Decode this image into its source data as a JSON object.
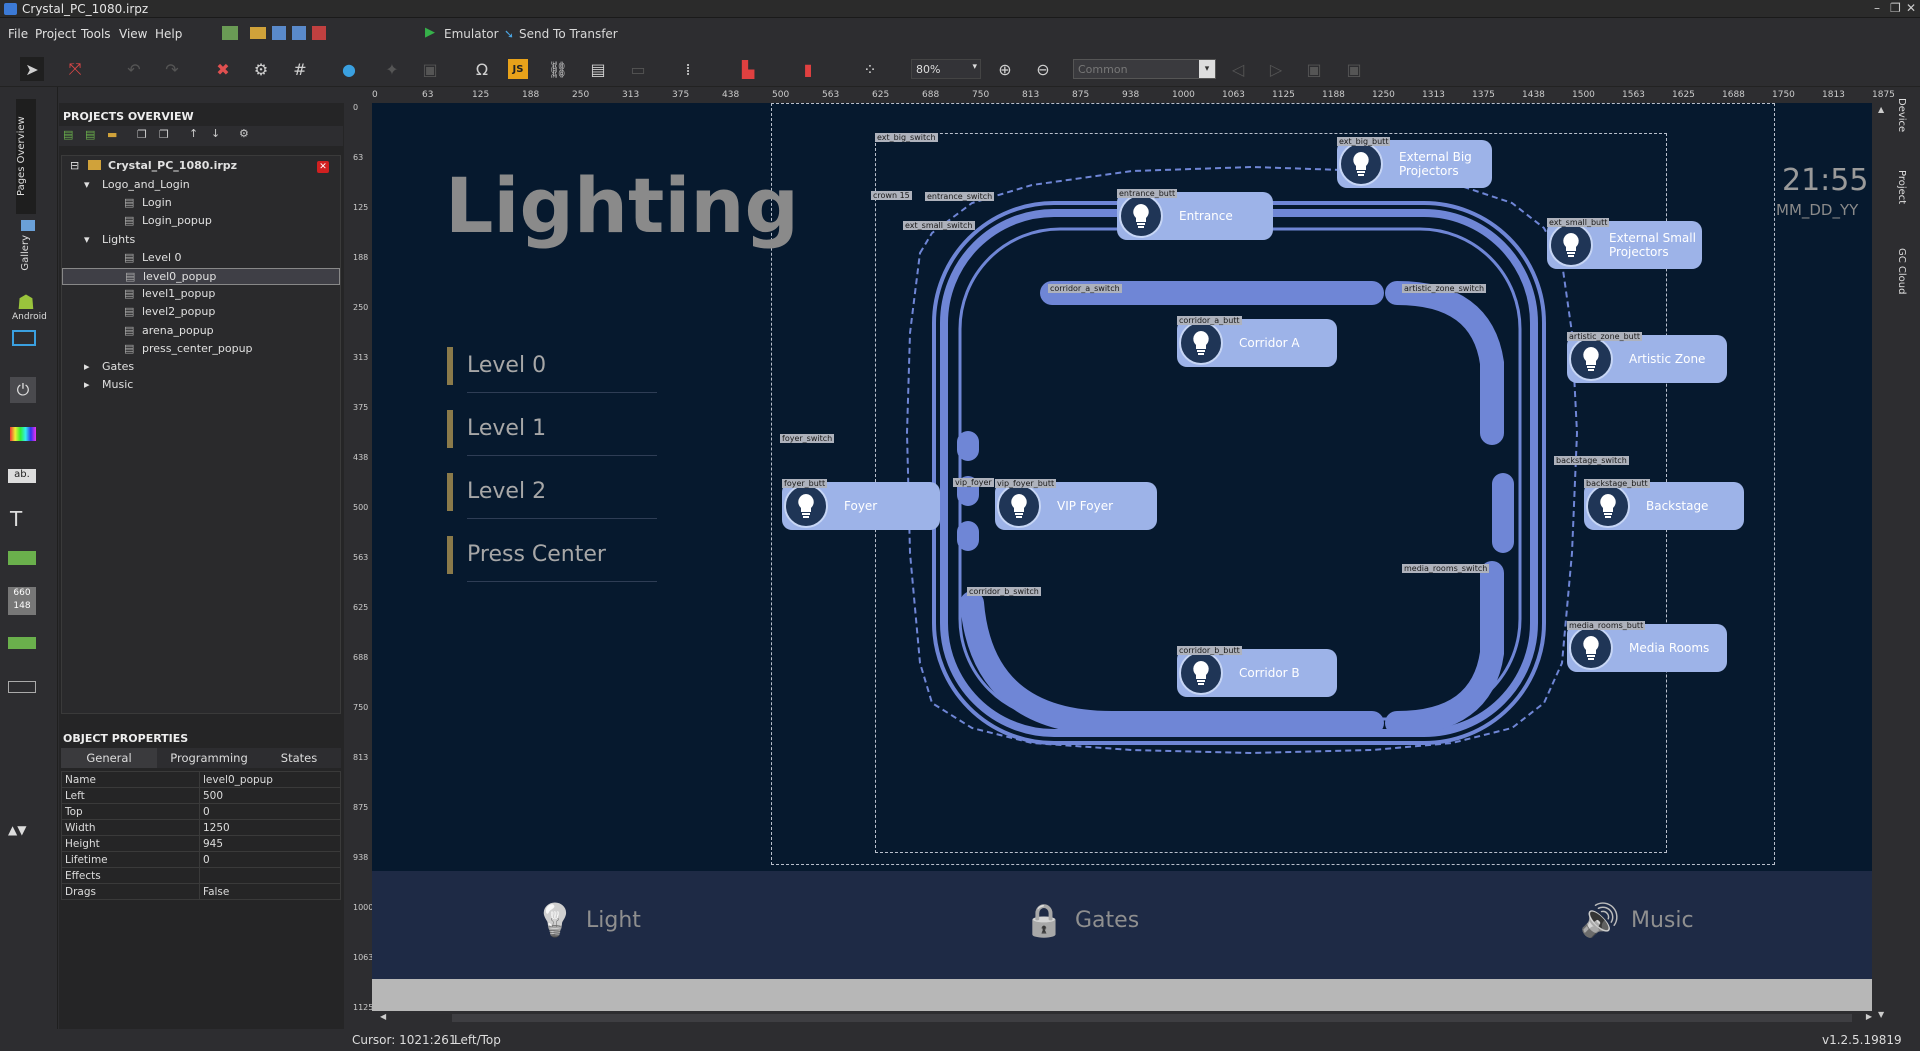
{
  "window": {
    "title": "Crystal_PC_1080.irpz",
    "controls": [
      "–",
      "❐",
      "✕"
    ]
  },
  "menu": {
    "items": [
      "File",
      "Project",
      "Tools",
      "View",
      "Help"
    ],
    "emulator": "Emulator",
    "send": "Send To Transfer"
  },
  "toolbar": {
    "zoom": "80%",
    "style_select": "Common"
  },
  "lefttabs": {
    "pages": "Pages Overview",
    "gallery": "Gallery",
    "android": "Android"
  },
  "righttabs": [
    "Device",
    "Project",
    "GC Cloud"
  ],
  "projects": {
    "header": "PROJECTS OVERVIEW",
    "root": "Crystal_PC_1080.irpz",
    "items": [
      {
        "label": "Logo_and_Login",
        "level": 1,
        "type": "folder"
      },
      {
        "label": "Login",
        "level": 2,
        "type": "page"
      },
      {
        "label": "Login_popup",
        "level": 2,
        "type": "popup"
      },
      {
        "label": "Lights",
        "level": 1,
        "type": "folder"
      },
      {
        "label": "Level 0",
        "level": 2,
        "type": "page"
      },
      {
        "label": "level0_popup",
        "level": 2,
        "type": "popup",
        "selected": true
      },
      {
        "label": "level1_popup",
        "level": 2,
        "type": "popup"
      },
      {
        "label": "level2_popup",
        "level": 2,
        "type": "popup"
      },
      {
        "label": "arena_popup",
        "level": 2,
        "type": "popup"
      },
      {
        "label": "press_center_popup",
        "level": 2,
        "type": "popup"
      },
      {
        "label": "Gates",
        "level": 1,
        "type": "collapsed"
      },
      {
        "label": "Music",
        "level": 1,
        "type": "collapsed"
      }
    ]
  },
  "props": {
    "header": "OBJECT PROPERTIES",
    "tabs": [
      "General",
      "Programming",
      "States"
    ],
    "rows": [
      [
        "Name",
        "level0_popup"
      ],
      [
        "Left",
        "500"
      ],
      [
        "Top",
        "0"
      ],
      [
        "Width",
        "1250"
      ],
      [
        "Height",
        "945"
      ],
      [
        "Lifetime",
        "0"
      ],
      [
        "Effects",
        ""
      ],
      [
        "Drags",
        "False"
      ]
    ]
  },
  "ruler": {
    "top": [
      "0",
      "63",
      "125",
      "188",
      "250",
      "313",
      "375",
      "438",
      "500",
      "563",
      "625",
      "688",
      "750",
      "813",
      "875",
      "938",
      "1000",
      "1063",
      "1125",
      "1188",
      "1250",
      "1313",
      "1375",
      "1438",
      "1500",
      "1563",
      "1625",
      "1688",
      "1750",
      "1813",
      "1875"
    ],
    "left": [
      "0",
      "63",
      "125",
      "188",
      "250",
      "313",
      "375",
      "438",
      "500",
      "563",
      "625",
      "688",
      "750",
      "813",
      "875",
      "938",
      "1000",
      "1063",
      "1125"
    ]
  },
  "canvas": {
    "title": "Lighting",
    "time": "21:55",
    "date": "MM_DD_YY",
    "levels": [
      "Level 0",
      "Level 1",
      "Level 2",
      "Press Center"
    ],
    "buttons": [
      {
        "label": "External Big Projectors",
        "tag": "ext_big_butt"
      },
      {
        "label": "Entrance",
        "tag": "entrance_butt"
      },
      {
        "label": "External Small Projectors",
        "tag": "ext_small_butt"
      },
      {
        "label": "Corridor A",
        "tag": "corridor_a_butt"
      },
      {
        "label": "Artistic Zone",
        "tag": "artistic_zone_butt"
      },
      {
        "label": "Foyer",
        "tag": "foyer_butt"
      },
      {
        "label": "VIP Foyer",
        "tag": "vip_foyer_butt"
      },
      {
        "label": "Backstage",
        "tag": "backstage_butt"
      },
      {
        "label": "Corridor B",
        "tag": "corridor_b_butt"
      },
      {
        "label": "Media Rooms",
        "tag": "media_rooms_butt"
      }
    ],
    "tags": [
      "ext_big_switch",
      "crown 15",
      "entrance_switch",
      "ext_small_switch",
      "corridor_a_switch",
      "artistic_zone_switch",
      "foyer_switch",
      "vip_foyer",
      "backstage_switch",
      "media_rooms_switch",
      "corridor_b_switch"
    ],
    "nav": [
      {
        "label": "Light",
        "icon": "bulb-icon"
      },
      {
        "label": "Gates",
        "icon": "lock-icon"
      },
      {
        "label": "Music",
        "icon": "speaker-icon"
      }
    ]
  },
  "status": {
    "cursor": "Cursor: 1021:261",
    "anchor": "Left/Top",
    "version": "v1.2.5.19819"
  },
  "colors": {
    "canvas_bg": "#06192e",
    "accent": "#6f86d6",
    "pill": "#9db3e8",
    "navbar": "#1e2a45",
    "level_marker": "#8a7a4a"
  }
}
